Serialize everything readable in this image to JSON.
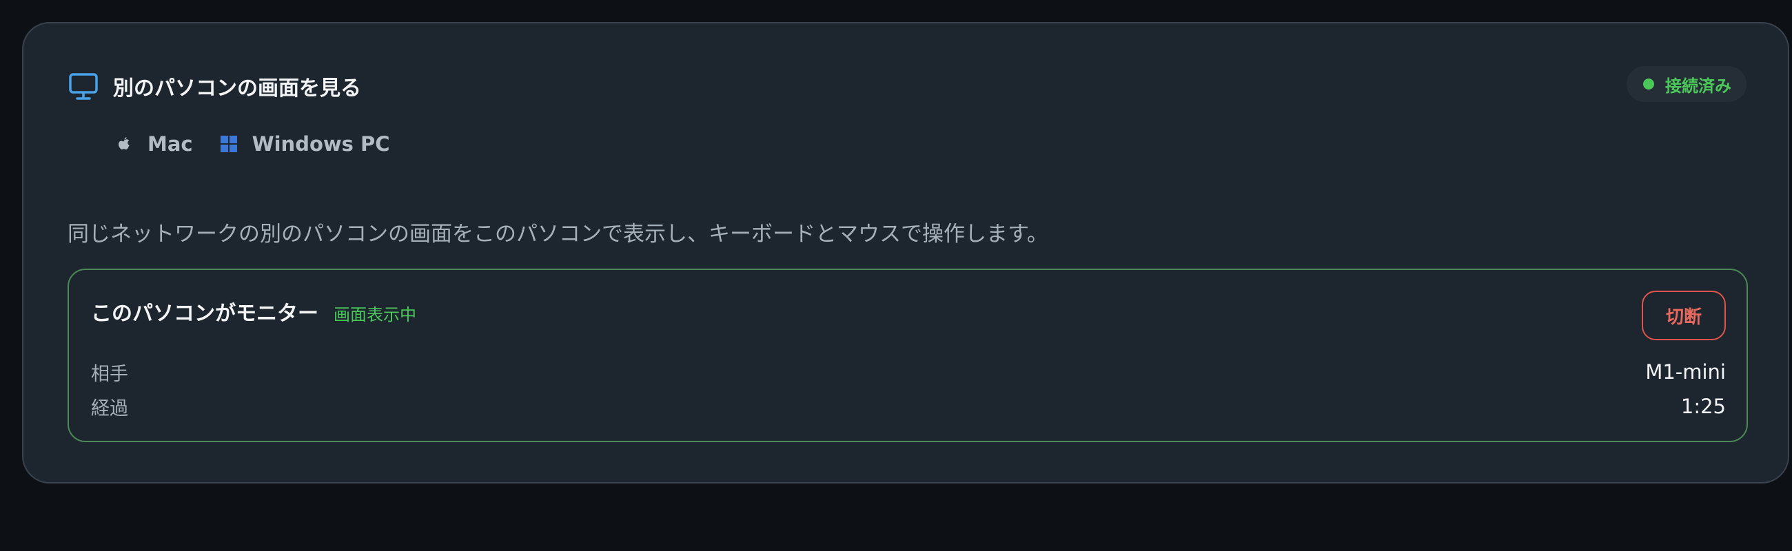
{
  "header": {
    "title": "別のパソコンの画面を見る",
    "title_icon": "monitor-icon",
    "status": "接続済み",
    "status_color": "#4cc85a"
  },
  "platforms": [
    {
      "icon": "apple-icon",
      "label": "Mac"
    },
    {
      "icon": "windows-icon",
      "label": "Windows PC"
    }
  ],
  "description": "同じネットワークの別のパソコンの画面をこのパソコンで表示し、キーボードとマウスで操作します。",
  "session": {
    "title": "このパソコンがモニター",
    "status": "画面表示中",
    "disconnect_label": "切断",
    "rows": [
      {
        "key": "相手",
        "value": "M1-mini"
      },
      {
        "key": "経過",
        "value": "1:25"
      }
    ]
  },
  "colors": {
    "accent_blue": "#4aa3e8",
    "success_green": "#4cc85a",
    "danger_red": "#e0554a"
  }
}
